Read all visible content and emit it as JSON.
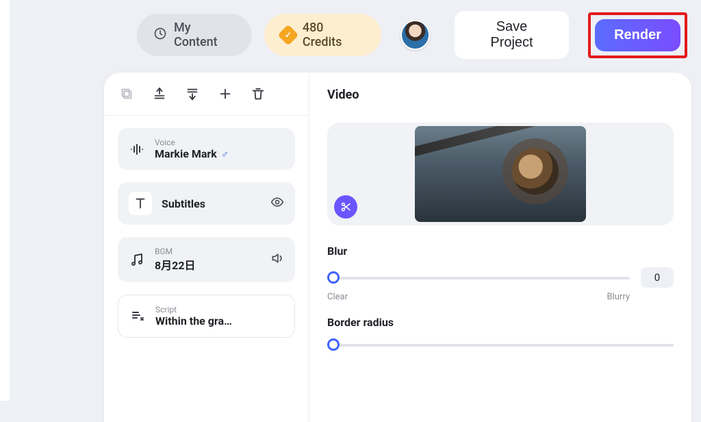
{
  "topbar": {
    "my_content_label": "My Content",
    "credits_label": "480 Credits",
    "save_label": "Save Project",
    "render_label": "Render"
  },
  "left_panel": {
    "voice": {
      "label": "Voice",
      "value": "Markie Mark"
    },
    "subtitles": {
      "label": "Subtitles"
    },
    "bgm": {
      "label": "BGM",
      "value": "8月22日"
    },
    "script": {
      "label": "Script",
      "value": "Within the gra…"
    }
  },
  "right_panel": {
    "title": "Video",
    "blur": {
      "label": "Blur",
      "value": "0",
      "min_label": "Clear",
      "max_label": "Blurry"
    },
    "border_radius": {
      "label": "Border radius"
    }
  }
}
